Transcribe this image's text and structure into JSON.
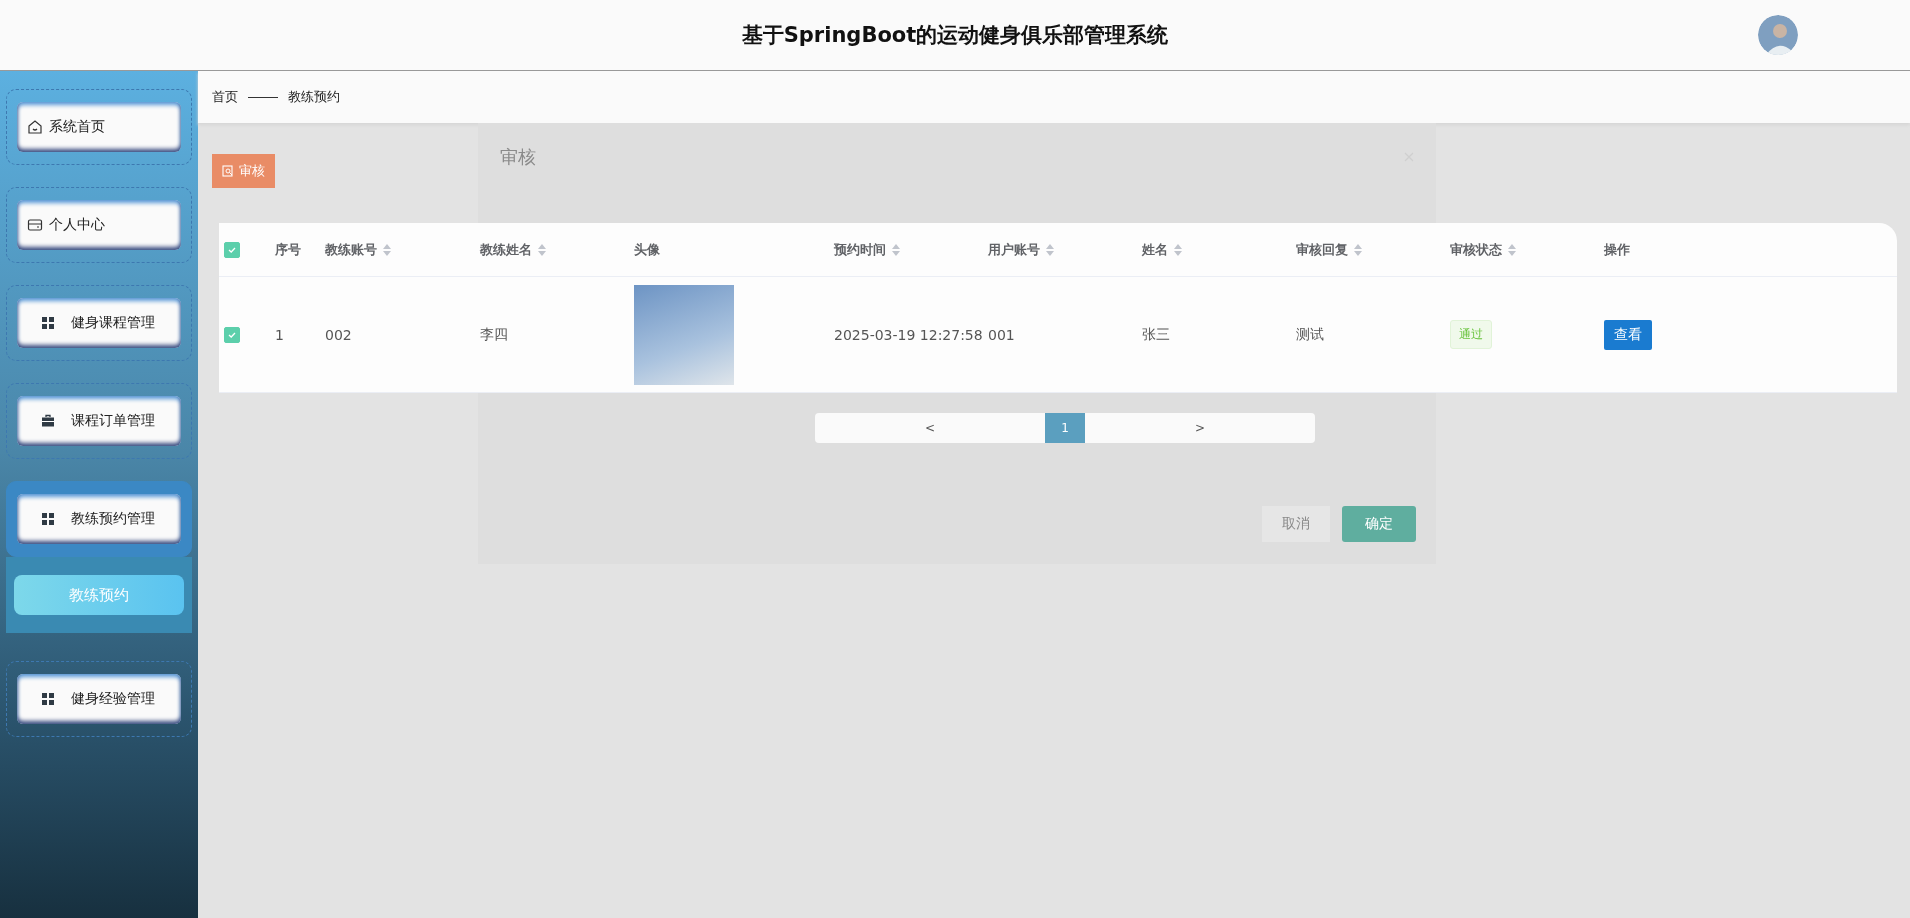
{
  "header": {
    "title": "基于SpringBoot的运动健身俱乐部管理系统"
  },
  "sidebar": {
    "items": [
      {
        "label": "系统首页",
        "kind": "home",
        "expanded": false
      },
      {
        "label": "个人中心",
        "kind": "card",
        "expanded": false
      },
      {
        "label": "健身课程管理",
        "kind": "grid",
        "expanded": false
      },
      {
        "label": "课程订单管理",
        "kind": "case",
        "expanded": false
      },
      {
        "label": "教练预约管理",
        "kind": "grid",
        "expanded": true,
        "children": [
          {
            "label": "教练预约",
            "selected": true
          }
        ]
      },
      {
        "label": "健身经验管理",
        "kind": "grid",
        "expanded": false
      }
    ]
  },
  "breadcrumb": [
    "首页",
    "教练预约"
  ],
  "toolbar": {
    "audit_button": "审核"
  },
  "dialog": {
    "title": "审核",
    "cancel": "取消",
    "confirm": "确定"
  },
  "table": {
    "all_checked": true,
    "columns": [
      {
        "label": "序号",
        "sortable": false
      },
      {
        "label": "教练账号",
        "sortable": true
      },
      {
        "label": "教练姓名",
        "sortable": true
      },
      {
        "label": "头像",
        "sortable": false
      },
      {
        "label": "预约时间",
        "sortable": true
      },
      {
        "label": "用户账号",
        "sortable": true
      },
      {
        "label": "姓名",
        "sortable": true
      },
      {
        "label": "审核回复",
        "sortable": true
      },
      {
        "label": "审核状态",
        "sortable": true
      },
      {
        "label": "操作",
        "sortable": false
      }
    ],
    "rows": [
      {
        "checked": true,
        "index": "1",
        "coach_account": "002",
        "coach_name": "李四",
        "booking_time": "2025-03-19 12:27:58",
        "user_account": "001",
        "name": "张三",
        "reply": "测试",
        "status": "通过",
        "action": "查看"
      }
    ]
  },
  "pagination": {
    "prev": "<",
    "pages": [
      {
        "label": "1",
        "selected": true
      }
    ],
    "next": ">"
  }
}
